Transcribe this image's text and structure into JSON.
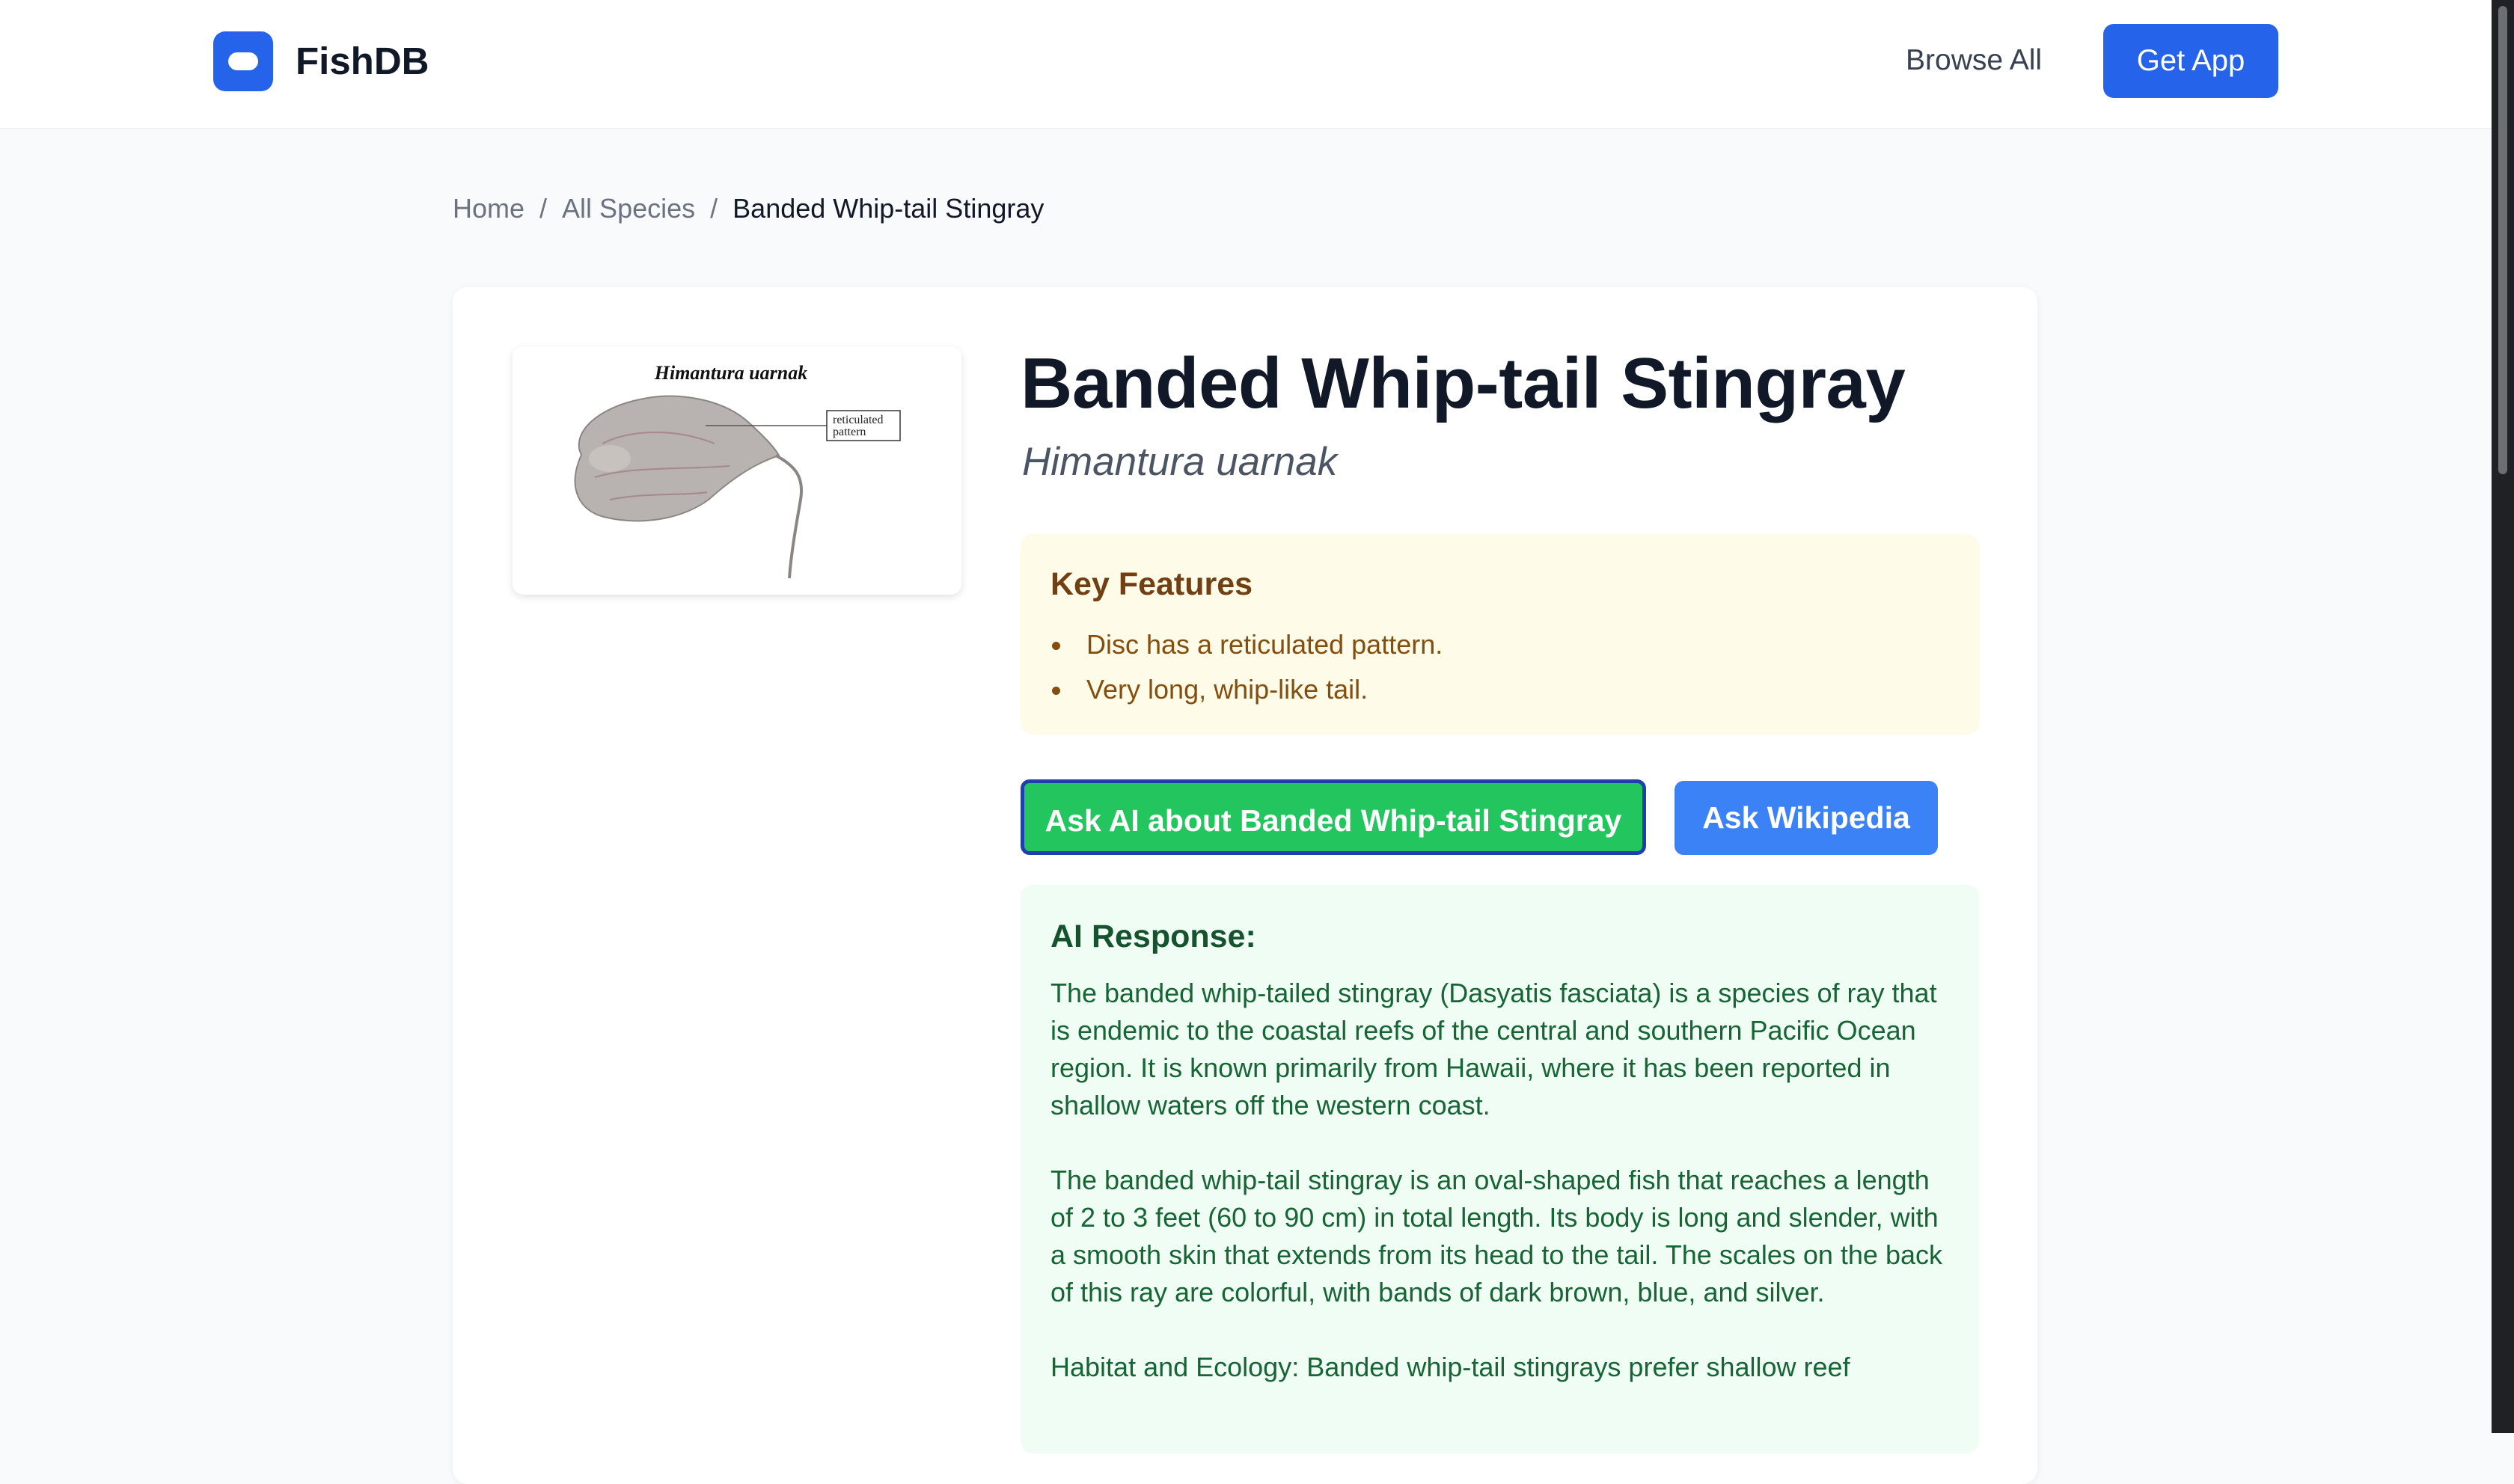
{
  "header": {
    "brand": "FishDB",
    "nav_browse": "Browse All",
    "cta": "Get App"
  },
  "breadcrumb": {
    "home": "Home",
    "sep": "/",
    "all_species": "All Species",
    "current": "Banded Whip-tail Stingray"
  },
  "species": {
    "common_name": "Banded Whip-tail Stingray",
    "scientific_name": "Himantura uarnak",
    "image": {
      "caption": "Himantura uarnak",
      "label_line1": "reticulated",
      "label_line2": "pattern"
    }
  },
  "key_features": {
    "title": "Key Features",
    "items": [
      "Disc has a reticulated pattern.",
      "Very long, whip-like tail."
    ]
  },
  "actions": {
    "ask_ai": "Ask AI about Banded Whip-tail Stingray",
    "ask_wiki": "Ask Wikipedia"
  },
  "ai_response": {
    "title": "AI Response:",
    "paragraphs": [
      "The banded whip-tailed stingray (Dasyatis fasciata) is a species of ray that is endemic to the coastal reefs of the central and southern Pacific Ocean region. It is known primarily from Hawaii, where it has been reported in shallow waters off the western coast.",
      "The banded whip-tail stingray is an oval-shaped fish that reaches a length of 2 to 3 feet (60 to 90 cm) in total length. Its body is long and slender, with a smooth skin that extends from its head to the tail. The scales on the back of this ray are colorful, with bands of dark brown, blue, and silver.",
      "Habitat and Ecology: Banded whip-tail stingrays prefer shallow reef"
    ]
  },
  "colors": {
    "brand_blue": "#2563eb",
    "ai_button_green": "#22c55e",
    "wiki_button_blue": "#3b82f6",
    "features_bg": "#fefce8",
    "ai_response_bg": "#f0fdf4"
  },
  "icons": {
    "logo": "app-logo-icon",
    "bullet": "bullet-dot-icon"
  }
}
